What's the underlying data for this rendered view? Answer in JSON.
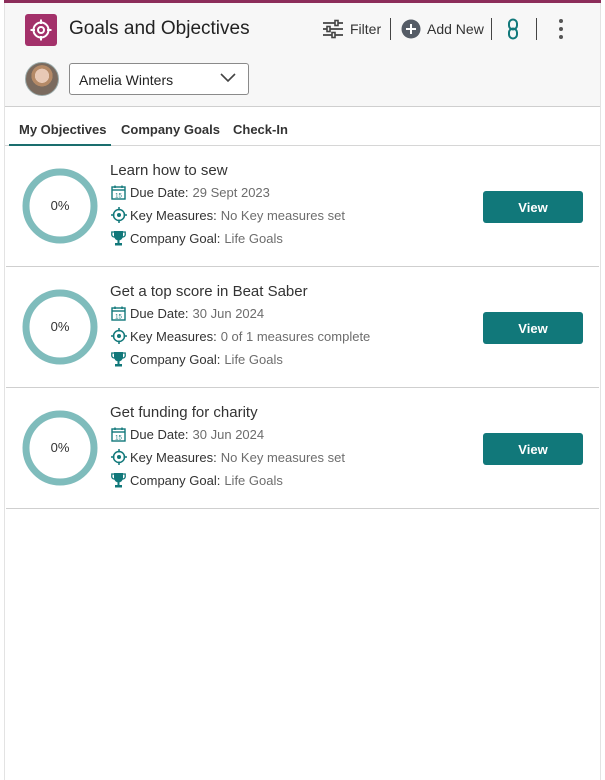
{
  "app": {
    "title": "Goals and Objectives"
  },
  "toolbar": {
    "filter_label": "Filter",
    "add_new_label": "Add New"
  },
  "user_select": {
    "selected": "Amelia Winters"
  },
  "tabs": [
    {
      "label": "My Objectives",
      "active": true
    },
    {
      "label": "Company Goals",
      "active": false
    },
    {
      "label": "Check-In",
      "active": false
    }
  ],
  "labels": {
    "due_date": "Due Date:",
    "key_measures": "Key Measures:",
    "company_goal": "Company Goal:",
    "view": "View"
  },
  "objectives": [
    {
      "title": "Learn how to sew",
      "progress_text": "0%",
      "progress": 0,
      "due_date": "29 Sept 2023",
      "key_measures": "No Key measures set",
      "company_goal": "Life Goals"
    },
    {
      "title": "Get a top score in Beat Saber",
      "progress_text": "0%",
      "progress": 0,
      "due_date": "30 Jun 2024",
      "key_measures": "0 of 1 measures complete",
      "company_goal": "Life Goals"
    },
    {
      "title": "Get funding for charity",
      "progress_text": "0%",
      "progress": 0,
      "due_date": "30 Jun 2024",
      "key_measures": "No Key measures set",
      "company_goal": "Life Goals"
    }
  ],
  "colors": {
    "accent": "#8c2d5a",
    "app_icon": "#a3316a",
    "teal": "#11787a",
    "ring": "#7fbcbc"
  },
  "icons": [
    "target-icon",
    "filter-sliders-icon",
    "add-circle-icon",
    "link-icon",
    "more-vertical-icon",
    "chevron-down-icon",
    "calendar-icon",
    "target-icon",
    "trophy-icon"
  ]
}
